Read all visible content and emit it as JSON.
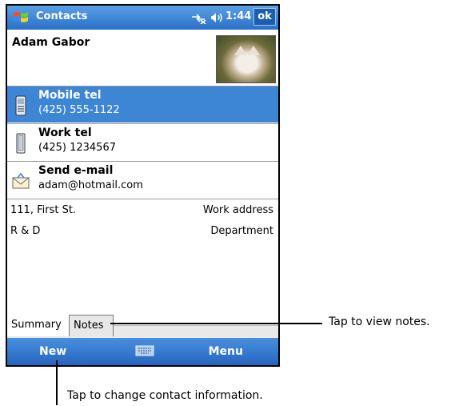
{
  "titlebar": {
    "app_title": "Contacts",
    "time": "1:44",
    "ok_label": "ok"
  },
  "contact": {
    "name": "Adam Gabor",
    "mobile": {
      "label": "Mobile tel",
      "value": "(425) 555-1122"
    },
    "work": {
      "label": "Work tel",
      "value": "(425) 1234567"
    },
    "email": {
      "label": "Send e-mail",
      "value": "adam@hotmail.com"
    },
    "fields": [
      {
        "value": "111, First St.",
        "label": "Work address"
      },
      {
        "value": "R & D",
        "label": "Department"
      }
    ]
  },
  "tabs": [
    {
      "label": "Summary"
    },
    {
      "label": "Notes"
    }
  ],
  "menubar": {
    "new_label": "New",
    "menu_label": "Menu"
  },
  "callouts": {
    "notes": "Tap to view notes.",
    "new": "Tap to change contact information."
  },
  "colors": {
    "titlebar": "#2a70c8",
    "selected_row": "#3d86d6",
    "menubar": "#2565bf"
  }
}
